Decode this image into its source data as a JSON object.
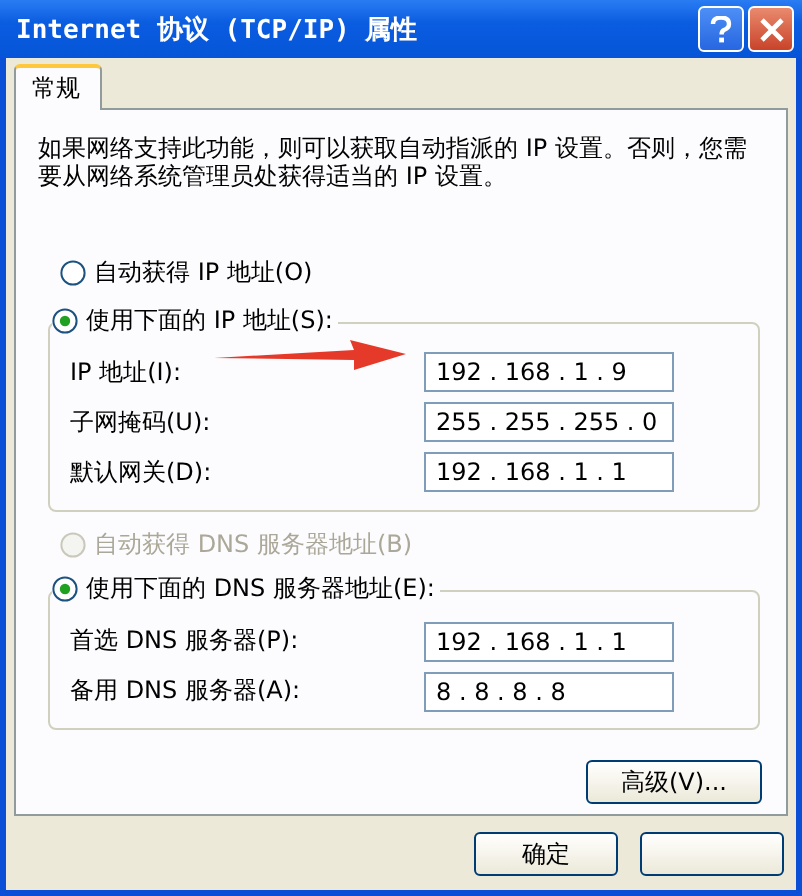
{
  "window": {
    "title": "Internet 协议 (TCP/IP) 属性"
  },
  "tabs": [
    {
      "label": "常规",
      "selected": true
    }
  ],
  "description": "如果网络支持此功能，则可以获取自动指派的 IP 设置。否则，您需要从网络系统管理员处获得适当的 IP 设置。",
  "ip_mode": [
    {
      "label": "自动获得 IP 地址(O)",
      "selected": false,
      "disabled": false
    },
    {
      "label": "使用下面的 IP 地址(S):",
      "selected": true,
      "disabled": false
    }
  ],
  "ip_fields": [
    {
      "label": "IP 地址(I):",
      "value": "192 . 168 . 1 . 9"
    },
    {
      "label": "子网掩码(U):",
      "value": "255 . 255 . 255 . 0"
    },
    {
      "label": "默认网关(D):",
      "value": "192 . 168 . 1 . 1"
    }
  ],
  "dns_mode": [
    {
      "label": "自动获得 DNS 服务器地址(B)",
      "selected": false,
      "disabled": true
    },
    {
      "label": "使用下面的 DNS 服务器地址(E):",
      "selected": true,
      "disabled": false
    }
  ],
  "dns_fields": [
    {
      "label": "首选 DNS 服务器(P):",
      "value": "192 . 168 . 1 . 1"
    },
    {
      "label": "备用 DNS 服务器(A):",
      "value": "8 . 8 . 8 . 8"
    }
  ],
  "advanced_button": "高级(V)...",
  "buttons": [
    {
      "kind": "labeled",
      "label": "确定"
    },
    {
      "kind": "blank"
    }
  ]
}
